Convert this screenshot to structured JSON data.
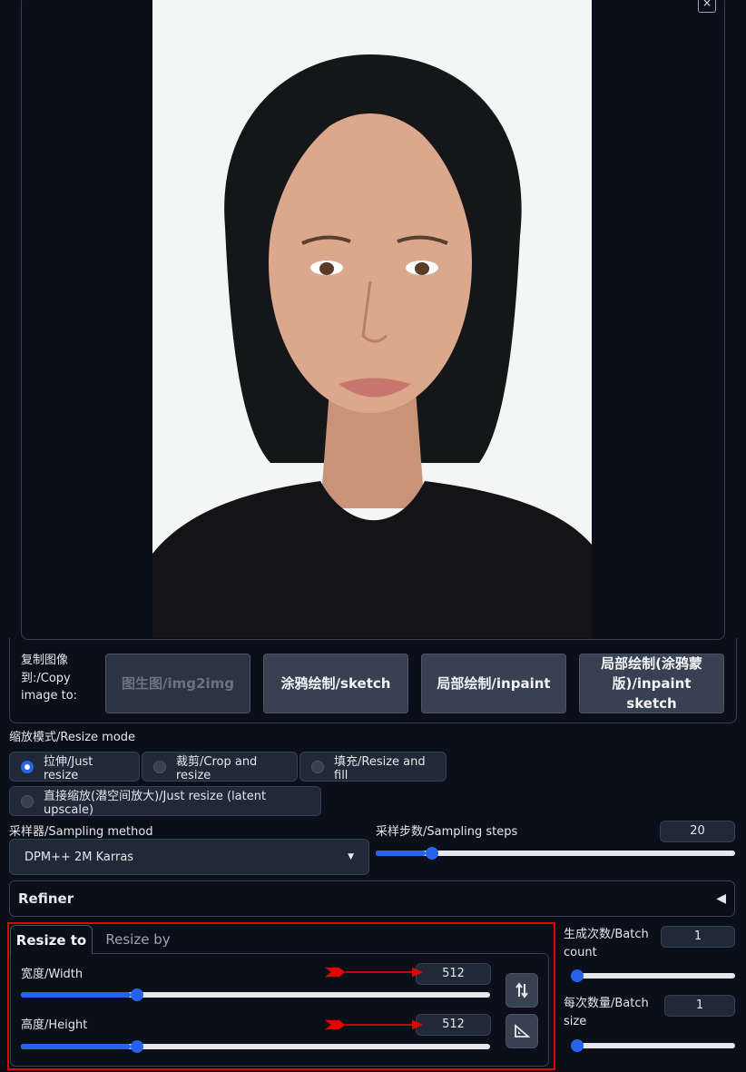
{
  "image_panel": {
    "close_label": "×",
    "image_description": "portrait photo"
  },
  "copy_to": {
    "label": "复制图像到:/Copy image to:",
    "buttons": [
      "图生图/img2img",
      "涂鸦绘制/sketch",
      "局部绘制/inpaint",
      "局部绘制(涂鸦蒙版)/inpaint sketch"
    ]
  },
  "resize_mode": {
    "label": "缩放模式/Resize mode",
    "options": [
      "拉伸/Just resize",
      "裁剪/Crop and resize",
      "填充/Resize and fill",
      "直接缩放(潜空间放大)/Just resize (latent upscale)"
    ],
    "selected": "拉伸/Just resize"
  },
  "sampler": {
    "label": "采样器/Sampling method",
    "value": "DPM++ 2M Karras"
  },
  "steps": {
    "label": "采样步数/Sampling steps",
    "value": "20",
    "fraction": 0.14
  },
  "refiner": {
    "label": "Refiner",
    "toggle_icon": "triangle-left-icon"
  },
  "resize_tabs": {
    "tabs": [
      "Resize to",
      "Resize by"
    ],
    "active": "Resize to",
    "width": {
      "label": "宽度/Width",
      "value": "512",
      "fraction": 0.234
    },
    "height": {
      "label": "高度/Height",
      "value": "512",
      "fraction": 0.234
    },
    "swap_icon": "swap-arrows-icon",
    "ratio_icon": "triangle-ruler-icon"
  },
  "batch": {
    "count_label": "生成次数/Batch count",
    "count_value": "1",
    "count_fraction": 0.0,
    "size_label": "每次数量/Batch size",
    "size_value": "1",
    "size_fraction": 0.0
  },
  "colors": {
    "accent": "#2563eb",
    "highlight": "#e10600",
    "background": "#0b0f19"
  }
}
